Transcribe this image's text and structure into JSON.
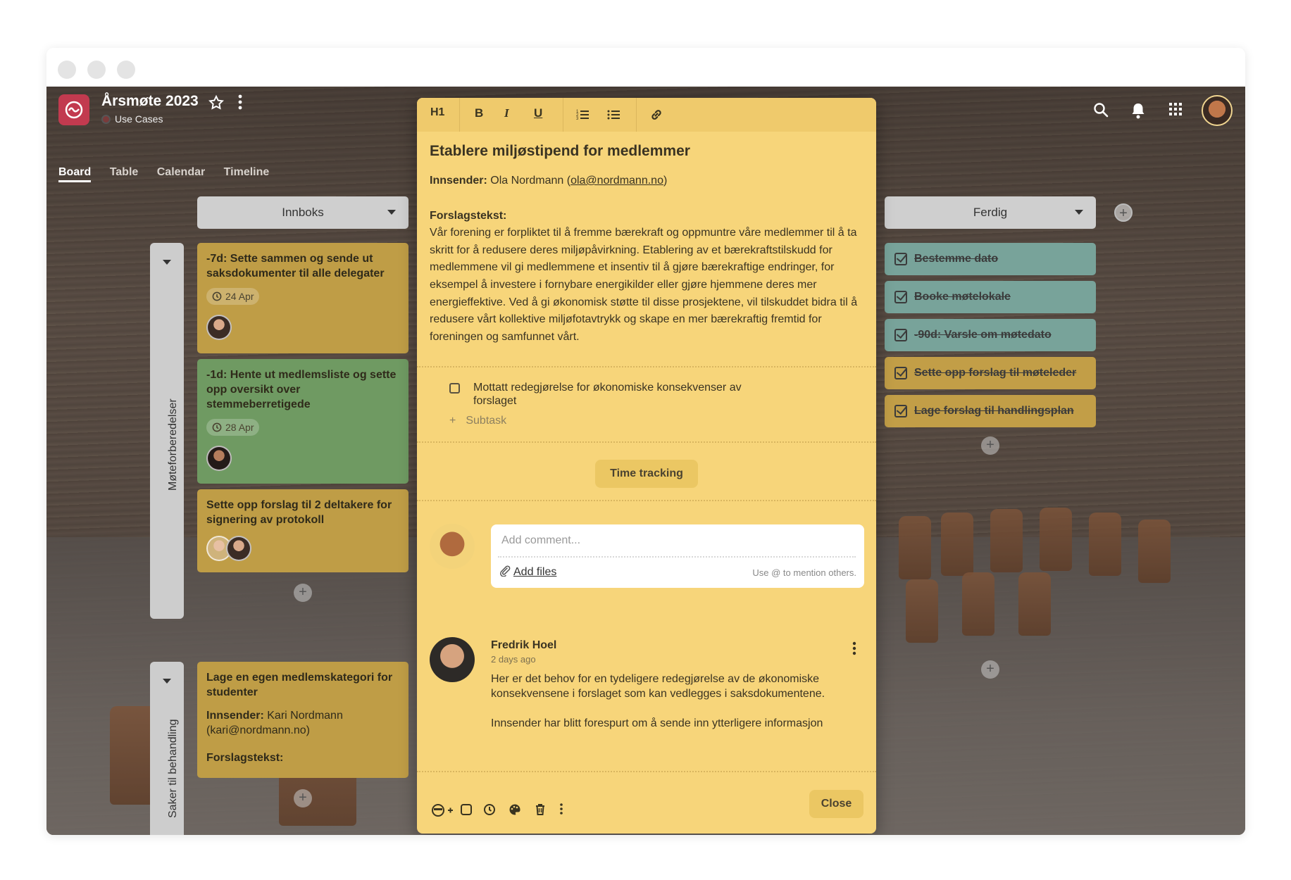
{
  "window": {
    "controls": [
      "close",
      "minimize",
      "maximize"
    ]
  },
  "header": {
    "title": "Årsmøte 2023",
    "subtitle": "Use Cases",
    "icons": [
      "app-logo-icon",
      "star-icon",
      "more-vertical-icon",
      "search-icon",
      "bell-icon",
      "apps-grid-icon",
      "user-avatar"
    ]
  },
  "tabs": [
    {
      "label": "Board",
      "active": true
    },
    {
      "label": "Table",
      "active": false
    },
    {
      "label": "Calendar",
      "active": false
    },
    {
      "label": "Timeline",
      "active": false
    }
  ],
  "lanes": [
    {
      "label": "Møteforberedelser"
    },
    {
      "label": "Saker til behandling"
    }
  ],
  "columns": {
    "inbox": {
      "label": "Innboks"
    },
    "done": {
      "label": "Ferdig"
    }
  },
  "inbox_cards": [
    {
      "title": "-7d: Sette sammen og sende ut saksdokumenter til alle delegater",
      "date": "24 Apr",
      "color": "#bf9d46"
    },
    {
      "title": "-1d: Hente ut medlemsliste og sette opp oversikt over stemmeberretigede",
      "date": "28 Apr",
      "color": "#6f9a62"
    },
    {
      "title": "Sette opp forslag til 2 deltakere for signering av protokoll",
      "color": "#bf9d46"
    }
  ],
  "lane2_card": {
    "title": "Lage en egen medlemskategori for studenter",
    "submitter_label": "Innsender:",
    "submitter": "Kari Nordmann (kari@nordmann.no)",
    "proposal_label": "Forslagstekst:"
  },
  "done_cards": [
    {
      "title": "Bestemme dato",
      "color": "#78a39a"
    },
    {
      "title": "Booke møtelokale",
      "color": "#78a39a"
    },
    {
      "title": "-90d: Varsle om møtedato",
      "color": "#78a39a"
    },
    {
      "title": "Sette opp forslag til møteleder",
      "color": "#c29e47"
    },
    {
      "title": "Lage forslag til handlingsplan",
      "color": "#c29e47"
    }
  ],
  "modal": {
    "toolbar": {
      "h1": "H1",
      "bold": "B",
      "italic": "I",
      "underline": "U"
    },
    "title": "Etablere miljøstipend for medlemmer",
    "submitter_label": "Innsender:",
    "submitter_name": "Ola Nordmann (",
    "submitter_email": "ola@nordmann.no",
    "submitter_close": ")",
    "proposal_label": "Forslagstekst:",
    "proposal_text": "Vår forening er forpliktet til å fremme bærekraft og oppmuntre våre medlemmer til å ta skritt for å redusere deres miljøpåvirkning. Etablering av et bærekraftstilskudd for medlemmene vil gi medlemmene et insentiv til å gjøre bærekraftige endringer, for eksempel å investere i fornybare energikilder eller gjøre hjemmene deres mer energieffektive. Ved å gi økonomisk støtte til disse prosjektene, vil tilskuddet bidra til å redusere vårt kollektive miljøfotavtrykk og skape en mer bærekraftig fremtid for foreningen og samfunnet vårt.",
    "subtask": "Mottatt redegjørelse for økonomiske konsekvenser av forslaget",
    "subtask_add": "Subtask",
    "time_tracking": "Time tracking",
    "comment_placeholder": "Add comment...",
    "add_files": "Add files",
    "mention_hint": "Use @ to mention others.",
    "comment": {
      "author": "Fredrik Hoel",
      "time": "2 days ago",
      "paragraphs": [
        "Her er det behov for en tydeligere redegjørelse av de økonomiske konsekvensene i forslaget som kan vedlegges i saksdokumentene.",
        "Innsender har blitt forespurt om å sende inn ytterligere informasjon"
      ]
    },
    "close": "Close"
  },
  "colors": {
    "modal_bg": "#f7d57a",
    "accent": "#c23a4f"
  }
}
